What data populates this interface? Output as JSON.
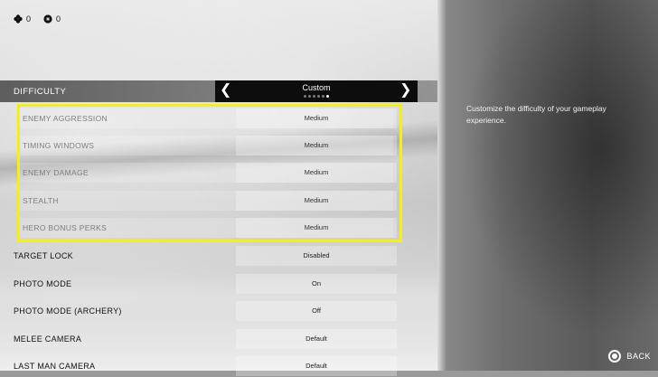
{
  "counters": [
    {
      "icon": "flower-icon",
      "value": "0"
    },
    {
      "icon": "coin-icon",
      "value": "0"
    }
  ],
  "difficulty": {
    "label": "DIFFICULTY",
    "value": "Custom",
    "dots_total": 6,
    "dots_active_index": 5
  },
  "sub_settings": [
    {
      "label": "ENEMY AGGRESSION",
      "value": "Medium"
    },
    {
      "label": "TIMING WINDOWS",
      "value": "Medium"
    },
    {
      "label": "ENEMY DAMAGE",
      "value": "Medium"
    },
    {
      "label": "STEALTH",
      "value": "Medium"
    },
    {
      "label": "HERO BONUS PERKS",
      "value": "Medium"
    }
  ],
  "settings": [
    {
      "label": "TARGET LOCK",
      "value": "Disabled"
    },
    {
      "label": "PHOTO MODE",
      "value": "On"
    },
    {
      "label": "PHOTO MODE (ARCHERY)",
      "value": "Off"
    },
    {
      "label": "MELEE CAMERA",
      "value": "Default"
    },
    {
      "label": "LAST MAN CAMERA",
      "value": "Default"
    }
  ],
  "description": "Customize the difficulty of your gameplay experience.",
  "back_label": "BACK",
  "colors": {
    "highlight": "#f2ee1f",
    "selector_bg": "#0d0d0d"
  }
}
